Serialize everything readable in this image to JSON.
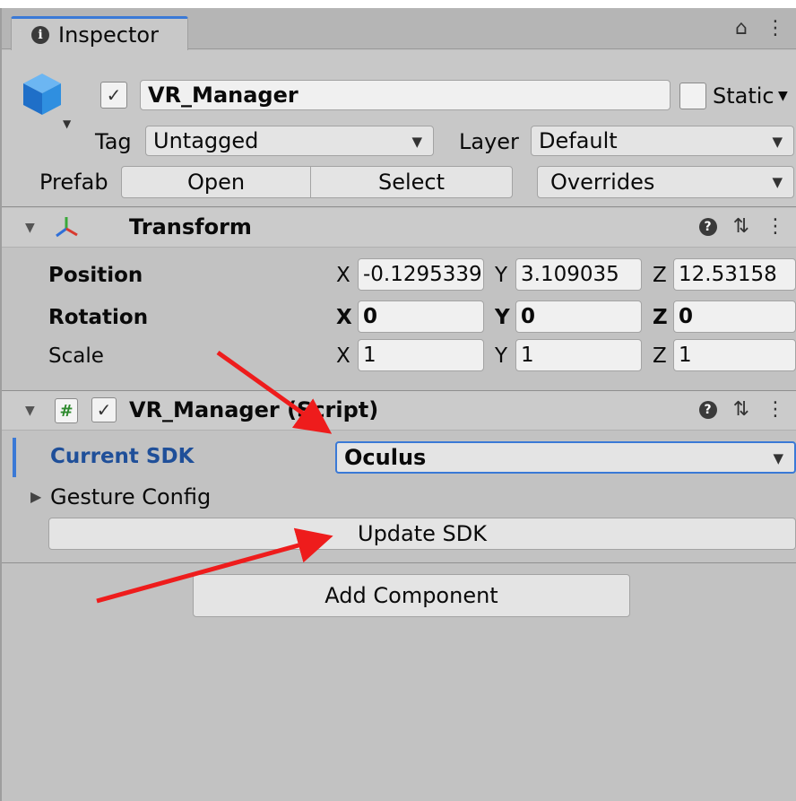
{
  "inspector": {
    "tab_title": "Inspector",
    "lock_glyph": "⌂",
    "menu_glyph": "⋮"
  },
  "object": {
    "name": "VR_Manager",
    "active_check": "✓",
    "static_label": "Static",
    "tag_label": "Tag",
    "tag_value": "Untagged",
    "layer_label": "Layer",
    "layer_value": "Default",
    "prefab_label": "Prefab",
    "open_label": "Open",
    "select_label": "Select",
    "overrides_label": "Overrides"
  },
  "transform": {
    "title": "Transform",
    "position_label": "Position",
    "rotation_label": "Rotation",
    "scale_label": "Scale",
    "x": "X",
    "y": "Y",
    "z": "Z",
    "position": {
      "x": "-0.1295339",
      "y": "3.109035",
      "z": "12.53158"
    },
    "rotation": {
      "x": "0",
      "y": "0",
      "z": "0"
    },
    "scale": {
      "x": "1",
      "y": "1",
      "z": "1"
    }
  },
  "script": {
    "title": "VR_Manager (Script)",
    "enabled_check": "✓",
    "current_sdk_label": "Current SDK",
    "current_sdk_value": "Oculus",
    "gesture_config_label": "Gesture Config",
    "update_sdk_label": "Update SDK"
  },
  "add_component_label": "Add Component",
  "colors": {
    "accent": "#3a79d6",
    "annotation_arrow": "#ee1c1c",
    "cube": "#2f8fe0"
  }
}
